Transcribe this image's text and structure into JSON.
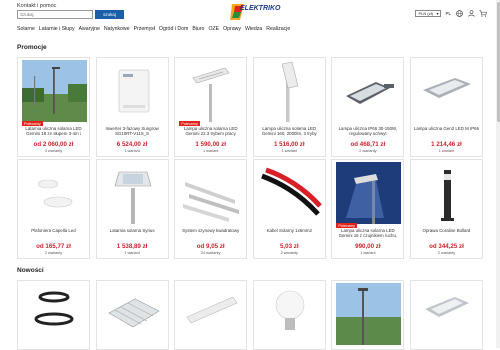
{
  "header": {
    "contact_label": "Kontakt i pomoc",
    "search_placeholder": "Szukaj",
    "search_button": "szukaj",
    "logo_text": "ELEKTRIKO",
    "currency": "PLN (zł)",
    "language": "PL"
  },
  "nav": [
    "Solarne",
    "Latarnie i Słupy",
    "Awaryjne",
    "Natynkowe",
    "Przemysł",
    "Ogród i Dom",
    "Biuro",
    "OZE",
    "Oprawy",
    "Wiedza",
    "Realizacje"
  ],
  "sections": {
    "promotions_title": "Promocje",
    "news_title": "Nowości"
  },
  "promotions": [
    {
      "name": "Latarnia uliczna solarna LED Gemini 18 ze słupem 3-4m i",
      "price": "od 2 060,00 zł",
      "variants": "3 warianty",
      "badge": "Polecamy"
    },
    {
      "name": "Inwerter 3-fazowy Sungrow SG10RT-V11S_S",
      "price": "6 524,00 zł",
      "variants": "1 wariant",
      "badge": ""
    },
    {
      "name": "Lampa uliczna solarna LED Gemini 22.3 trybem pracy",
      "price": "1 590,00 zł",
      "variants": "1 wariant",
      "badge": "Polecamy"
    },
    {
      "name": "Lampa uliczna solarna LED Gemini 160, 2000lm, 3 tryby",
      "price": "1 516,00 zł",
      "variants": "1 wariant",
      "badge": ""
    },
    {
      "name": "Lampa uliczna IP66 30-150W, regulowany uchwyt",
      "price": "od 468,71 zł",
      "variants": "2 warianty",
      "badge": ""
    },
    {
      "name": "Lampa uliczna Gen2 LED M IP66",
      "price": "1 214,46 zł",
      "variants": "1 wariant",
      "badge": ""
    },
    {
      "name": "Plafoniera Capella Led",
      "price": "od 165,77 zł",
      "variants": "2 warianty",
      "badge": ""
    },
    {
      "name": "Latarnia solarna Syrius",
      "price": "1 538,89 zł",
      "variants": "1 wariant",
      "badge": ""
    },
    {
      "name": "System szynowy kwadratowy",
      "price": "od 9,05 zł",
      "variants": "24 warianty",
      "badge": ""
    },
    {
      "name": "Kabel Solarny 1x6mm2",
      "price": "5,03 zł",
      "variants": "2 warianty",
      "badge": ""
    },
    {
      "name": "Lampa uliczna solarna LED Gemini 16 z czujnikiem ruchu,",
      "price": "990,00 zł",
      "variants": "1 wariant",
      "badge": "Polecamy"
    },
    {
      "name": "Oprawa Coraline Bollard",
      "price": "od 344,25 zł",
      "variants": "2 warianty",
      "badge": ""
    }
  ],
  "colors": {
    "accent_blue": "#1a5fa8",
    "price_red": "#d3212d",
    "badge_red": "#e2231a"
  }
}
